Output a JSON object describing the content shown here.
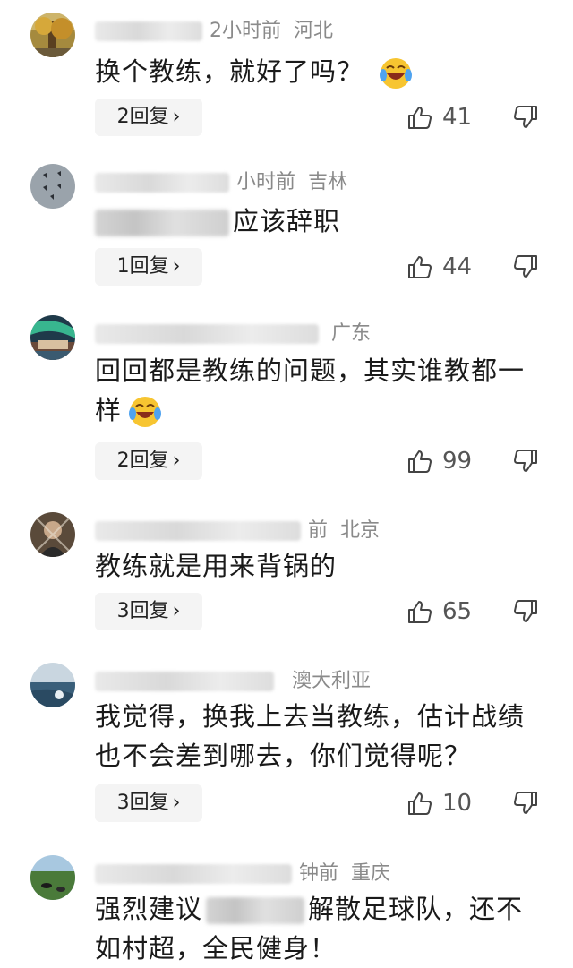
{
  "comments": [
    {
      "meta_visible": "2小时前",
      "region": "河北",
      "text": "换个教练，就好了吗？",
      "replies": "2回复",
      "likes": "41",
      "avatar": "autumn-tree-photo"
    },
    {
      "meta_visible": "小时前",
      "region": "吉林",
      "text_suffix": "应该辞职",
      "replies": "1回复",
      "likes": "44",
      "avatar": "jets-formation-photo"
    },
    {
      "meta_visible": "",
      "region": "广东",
      "text": "回回都是教练的问题，其实谁教都一样",
      "replies": "2回复",
      "likes": "99",
      "avatar": "aurora-house-photo"
    },
    {
      "meta_visible": "前",
      "region": "北京",
      "text": "教练就是用来背锅的",
      "replies": "3回复",
      "likes": "65",
      "avatar": "dark-portrait-photo"
    },
    {
      "meta_visible": "",
      "region": "澳大利亚",
      "text": "我觉得，换我上去当教练，估计战绩也不会差到哪去，你们觉得呢？",
      "replies": "3回复",
      "likes": "10",
      "avatar": "seaside-photo"
    },
    {
      "meta_visible": "钟前",
      "region": "重庆",
      "text_prefix": "强烈建议",
      "text_suffix": "解散足球队，还不如村超，全民健身！",
      "avatar": "pasture-cows-photo"
    }
  ],
  "icons": {
    "like": "thumbs-up-icon",
    "dislike": "thumbs-down-icon",
    "chevron": "chevron-right-icon",
    "emoji": "laughing-crying-emoji"
  },
  "colors": {
    "meta": "#8a8a8a",
    "text": "#1a1a1a",
    "reply_bg": "#f4f4f4"
  }
}
